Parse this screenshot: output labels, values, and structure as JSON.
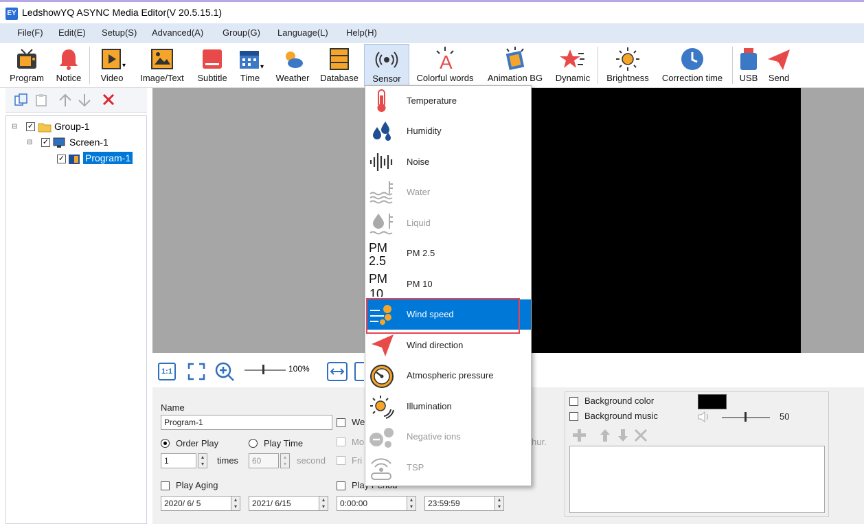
{
  "window": {
    "title": "LedshowYQ ASYNC Media Editor(V 20.5.15.1)",
    "icon_text": "EY"
  },
  "menubar": [
    "File(F)",
    "Edit(E)",
    "Setup(S)",
    "Advanced(A)",
    "Group(G)",
    "Language(L)",
    "Help(H)"
  ],
  "toolbar": {
    "program": "Program",
    "notice": "Notice",
    "video": "Video",
    "image_text": "Image/Text",
    "subtitle": "Subtitle",
    "time": "Time",
    "weather": "Weather",
    "database": "Database",
    "sensor": "Sensor",
    "colorful_words": "Colorful words",
    "animation_bg": "Animation BG",
    "dynamic": "Dynamic",
    "brightness": "Brightness",
    "correction_time": "Correction time",
    "usb": "USB",
    "send": "Send"
  },
  "tree": {
    "group": "Group-1",
    "screen": "Screen-1",
    "program": "Program-1"
  },
  "zoom": {
    "value": "100%"
  },
  "props": {
    "name_label": "Name",
    "name_value": "Program-1",
    "order_play": "Order Play",
    "play_time": "Play Time",
    "times_value": "1",
    "times_label": "times",
    "seconds_value": "60",
    "second_label": "second",
    "play_aging": "Play Aging",
    "play_period": "Play Period",
    "date_start": "2020/ 6/ 5",
    "date_end": "2021/ 6/15",
    "time_start": "0:00:00",
    "time_end": "23:59:59",
    "week_label": "We",
    "mo_label": "Mo",
    "fri_label": "Fri",
    "hour_label": "hur.",
    "bg_color": "Background color",
    "bg_music": "Background music",
    "volume": "50"
  },
  "colors": {
    "selection": "#0078d7",
    "highlight_border": "#e8434f",
    "menubar": "#dfe9f6",
    "canvas": "#a6a6a6"
  },
  "sensor_menu": [
    {
      "label": "Temperature",
      "icon": "thermometer-icon",
      "enabled": true
    },
    {
      "label": "Humidity",
      "icon": "droplets-icon",
      "enabled": true
    },
    {
      "label": "Noise",
      "icon": "soundwave-icon",
      "enabled": true
    },
    {
      "label": "Water",
      "icon": "water-level-icon",
      "enabled": false
    },
    {
      "label": "Liquid",
      "icon": "liquid-level-icon",
      "enabled": false
    },
    {
      "label": "PM 2.5",
      "icon": "pm25-icon",
      "enabled": true
    },
    {
      "label": "PM 10",
      "icon": "pm10-icon",
      "enabled": true
    },
    {
      "label": "Wind speed",
      "icon": "wind-speed-icon",
      "enabled": true,
      "selected": true
    },
    {
      "label": "Wind direction",
      "icon": "wind-direction-icon",
      "enabled": true
    },
    {
      "label": "Atmospheric pressure",
      "icon": "pressure-gauge-icon",
      "enabled": true
    },
    {
      "label": "Illumination",
      "icon": "sun-illumination-icon",
      "enabled": true
    },
    {
      "label": "Negative ions",
      "icon": "negative-ions-icon",
      "enabled": false
    },
    {
      "label": "TSP",
      "icon": "tsp-icon",
      "enabled": false
    }
  ],
  "pm_icons": {
    "pm25_top": "PM",
    "pm25_bottom": "2.5",
    "pm10_top": "PM",
    "pm10_bottom": "10"
  },
  "zoom_fit_label": "1:1"
}
